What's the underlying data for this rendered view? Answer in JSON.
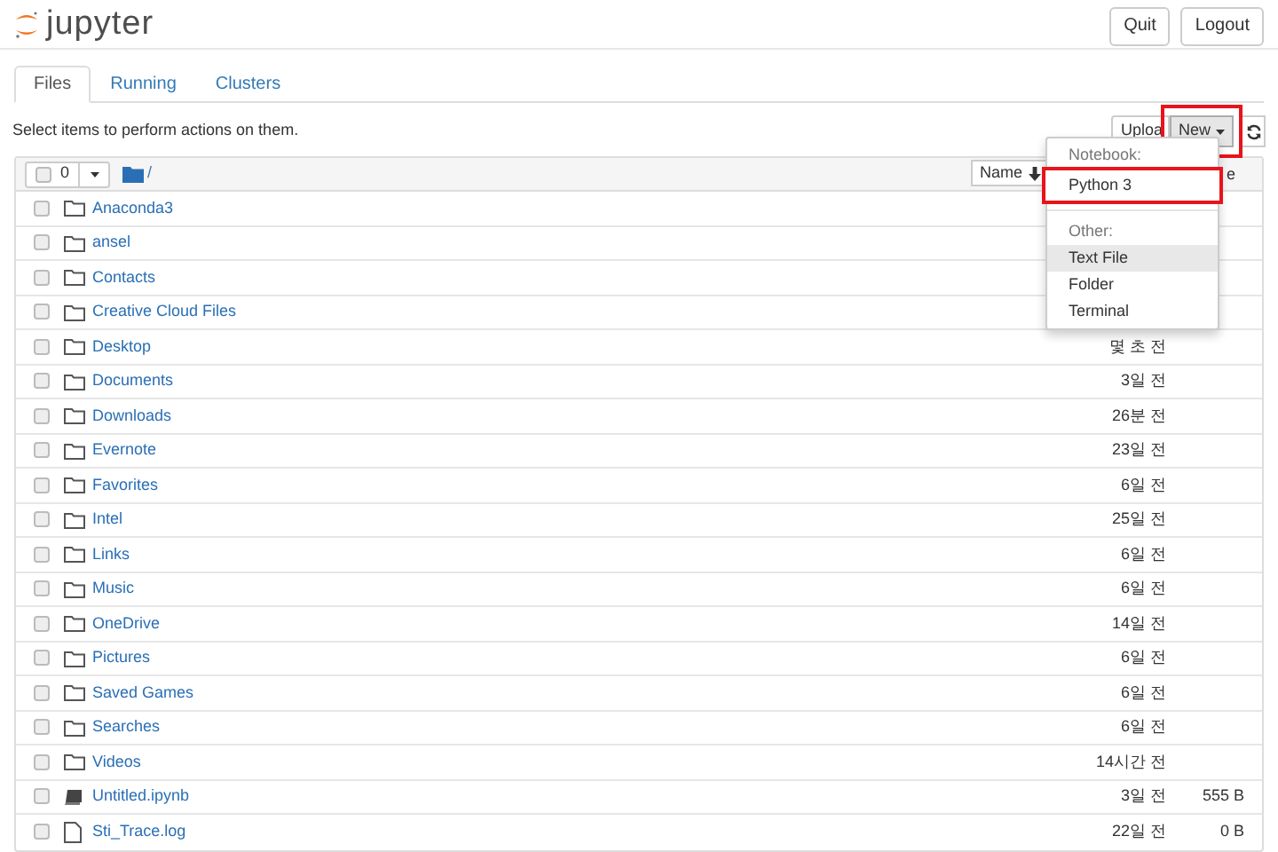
{
  "header": {
    "logo_text": "jupyter",
    "buttons": [
      "Quit",
      "Logout"
    ]
  },
  "tabs": [
    {
      "label": "Files",
      "selected": true
    },
    {
      "label": "Running",
      "selected": false
    },
    {
      "label": "Clusters",
      "selected": false
    }
  ],
  "hint": "Select items to perform actions on them.",
  "toolbar": {
    "upload": "Uploa",
    "new": {
      "label": "New",
      "highlighted": true
    }
  },
  "list_header": {
    "checked": false,
    "selected_count": "0",
    "path": "/",
    "sort_label": "Name",
    "column_3": "e"
  },
  "new_menu": {
    "sections": [
      {
        "heading": "Notebook:",
        "items": [
          {
            "label": "Python 3",
            "highlighted": true,
            "hovered": false
          }
        ]
      },
      {
        "heading": "Other:",
        "items": [
          {
            "label": "Text File",
            "highlighted": false,
            "hovered": true
          },
          {
            "label": "Folder",
            "highlighted": false,
            "hovered": false
          },
          {
            "label": "Terminal",
            "highlighted": false,
            "hovered": false
          }
        ]
      }
    ]
  },
  "rows": [
    {
      "kind": "folder",
      "checked": false,
      "name": "Anaconda3"
    },
    {
      "kind": "folder",
      "checked": false,
      "name": "ansel"
    },
    {
      "kind": "folder",
      "checked": false,
      "name": "Contacts"
    },
    {
      "kind": "folder",
      "checked": false,
      "name": "Creative Cloud Files"
    },
    {
      "kind": "folder",
      "checked": false,
      "name": "Desktop",
      "modified": "몇 초 전"
    },
    {
      "kind": "folder",
      "checked": false,
      "name": "Documents",
      "modified": "3일 전"
    },
    {
      "kind": "folder",
      "checked": false,
      "name": "Downloads",
      "modified": "26분 전"
    },
    {
      "kind": "folder",
      "checked": false,
      "name": "Evernote",
      "modified": "23일 전"
    },
    {
      "kind": "folder",
      "checked": false,
      "name": "Favorites",
      "modified": "6일 전"
    },
    {
      "kind": "folder",
      "checked": false,
      "name": "Intel",
      "modified": "25일 전"
    },
    {
      "kind": "folder",
      "checked": false,
      "name": "Links",
      "modified": "6일 전"
    },
    {
      "kind": "folder",
      "checked": false,
      "name": "Music",
      "modified": "6일 전"
    },
    {
      "kind": "folder",
      "checked": false,
      "name": "OneDrive",
      "modified": "14일 전"
    },
    {
      "kind": "folder",
      "checked": false,
      "name": "Pictures",
      "modified": "6일 전"
    },
    {
      "kind": "folder",
      "checked": false,
      "name": "Saved Games",
      "modified": "6일 전"
    },
    {
      "kind": "folder",
      "checked": false,
      "name": "Searches",
      "modified": "6일 전"
    },
    {
      "kind": "folder",
      "checked": false,
      "name": "Videos",
      "modified": "14시간 전"
    },
    {
      "kind": "notebook",
      "checked": false,
      "name": "Untitled.ipynb",
      "modified": "3일 전",
      "size": "555 B"
    },
    {
      "kind": "file",
      "checked": false,
      "name": "Sti_Trace.log",
      "modified": "22일 전",
      "size": "0 B"
    }
  ]
}
